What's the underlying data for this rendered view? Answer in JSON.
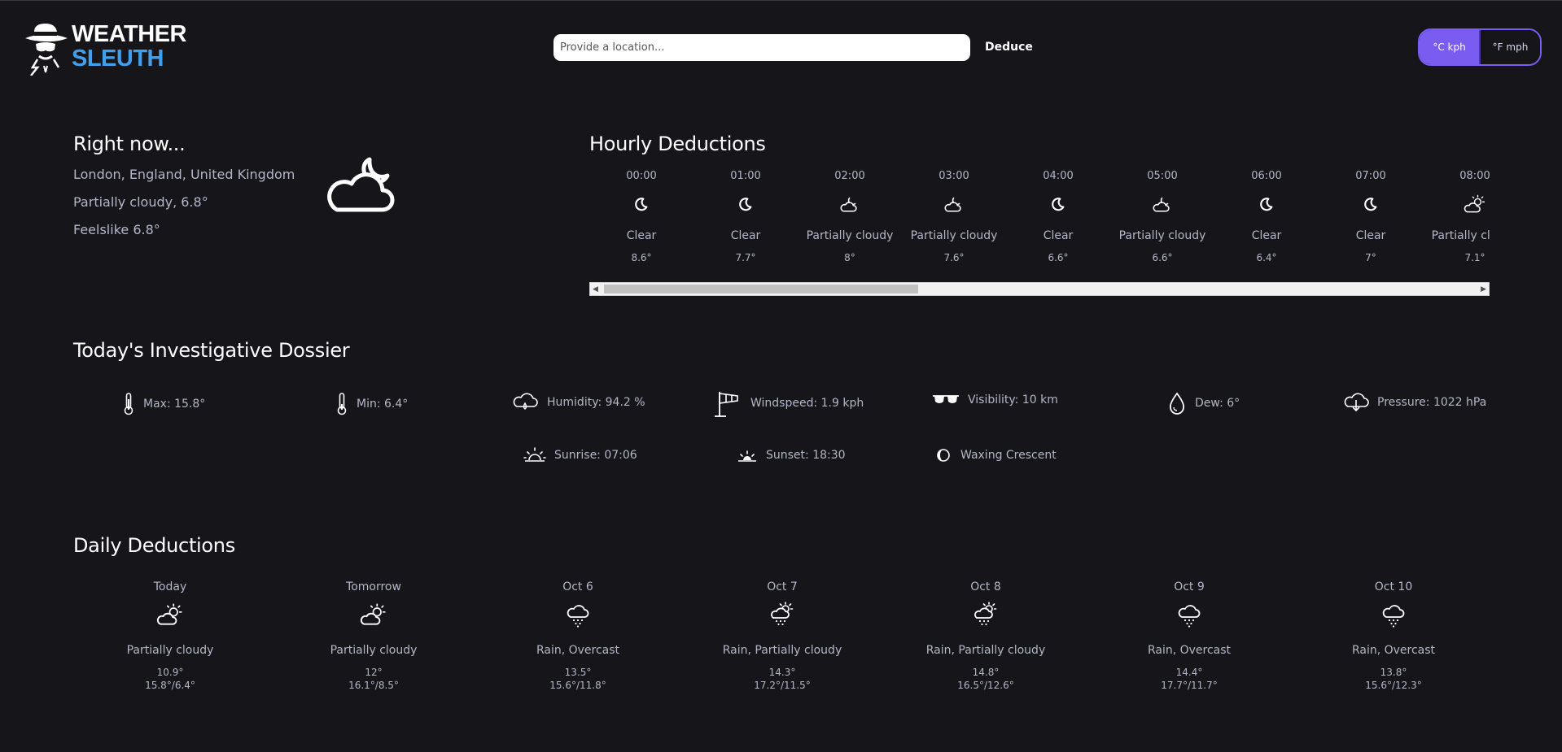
{
  "header": {
    "logo_word1": "WEATHER",
    "logo_word2": "SLEUTH",
    "search_placeholder": "Provide a location...",
    "deduce_label": "Deduce",
    "unit_metric": "°C kph",
    "unit_imperial": "°F mph"
  },
  "colors": {
    "accent": "#7b5cf0",
    "logo_blue": "#3fa0f0",
    "background": "#15151a"
  },
  "now": {
    "title": "Right now...",
    "location": "London, England, United Kingdom",
    "condition": "Partially cloudy, 6.8°",
    "feelslike": "Feelslike 6.8°",
    "icon": "partly-cloudy-night-icon"
  },
  "hourly": {
    "title": "Hourly Deductions",
    "items": [
      {
        "time": "00:00",
        "cond": "Clear",
        "temp": "8.6°",
        "icon": "clear-night-icon"
      },
      {
        "time": "01:00",
        "cond": "Clear",
        "temp": "7.7°",
        "icon": "clear-night-icon"
      },
      {
        "time": "02:00",
        "cond": "Partially cloudy",
        "temp": "8°",
        "icon": "partly-cloudy-night-icon"
      },
      {
        "time": "03:00",
        "cond": "Partially cloudy",
        "temp": "7.6°",
        "icon": "partly-cloudy-night-icon"
      },
      {
        "time": "04:00",
        "cond": "Clear",
        "temp": "6.6°",
        "icon": "clear-night-icon"
      },
      {
        "time": "05:00",
        "cond": "Partially cloudy",
        "temp": "6.6°",
        "icon": "partly-cloudy-night-icon"
      },
      {
        "time": "06:00",
        "cond": "Clear",
        "temp": "6.4°",
        "icon": "clear-night-icon"
      },
      {
        "time": "07:00",
        "cond": "Clear",
        "temp": "7°",
        "icon": "clear-night-icon"
      },
      {
        "time": "08:00",
        "cond": "Partially cloudy",
        "temp": "7.1°",
        "icon": "partly-cloudy-day-icon"
      }
    ]
  },
  "dossier": {
    "title": "Today's Investigative Dossier",
    "max": "Max: 15.8°",
    "min": "Min: 6.4°",
    "humidity": "Humidity: 94.2 %",
    "windspeed": "Windspeed: 1.9 kph",
    "visibility": "Visibility: 10 km",
    "dew": "Dew: 6°",
    "pressure": "Pressure: 1022 hPa",
    "sunrise": "Sunrise: 07:06",
    "sunset": "Sunset: 18:30",
    "moon": "Waxing Crescent"
  },
  "daily": {
    "title": "Daily Deductions",
    "items": [
      {
        "day": "Today",
        "cond": "Partially cloudy",
        "temp": "10.9°",
        "range": "15.8°/6.4°",
        "icon": "partly-cloudy-day-icon"
      },
      {
        "day": "Tomorrow",
        "cond": "Partially cloudy",
        "temp": "12°",
        "range": "16.1°/8.5°",
        "icon": "partly-cloudy-day-icon"
      },
      {
        "day": "Oct 6",
        "cond": "Rain, Overcast",
        "temp": "13.5°",
        "range": "15.6°/11.8°",
        "icon": "rain-icon"
      },
      {
        "day": "Oct 7",
        "cond": "Rain, Partially cloudy",
        "temp": "14.3°",
        "range": "17.2°/11.5°",
        "icon": "rain-sun-icon"
      },
      {
        "day": "Oct 8",
        "cond": "Rain, Partially cloudy",
        "temp": "14.8°",
        "range": "16.5°/12.6°",
        "icon": "rain-sun-icon"
      },
      {
        "day": "Oct 9",
        "cond": "Rain, Overcast",
        "temp": "14.4°",
        "range": "17.7°/11.7°",
        "icon": "rain-icon"
      },
      {
        "day": "Oct 10",
        "cond": "Rain, Overcast",
        "temp": "13.8°",
        "range": "15.6°/12.3°",
        "icon": "rain-icon"
      }
    ]
  }
}
